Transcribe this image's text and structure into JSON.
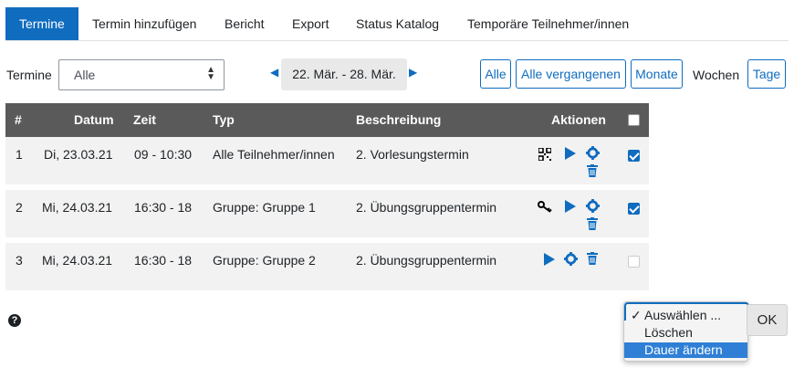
{
  "tabs": [
    "Termine",
    "Termin hinzufügen",
    "Bericht",
    "Export",
    "Status Katalog",
    "Temporäre Teilnehmer/innen"
  ],
  "filter": {
    "label": "Termine",
    "selected": "Alle"
  },
  "date_range": "22. Mär. - 28. Mär.",
  "view_buttons": [
    "Alle",
    "Alle vergangenen",
    "Monate"
  ],
  "view_plain": "Wochen",
  "view_last": "Tage",
  "table": {
    "headers": [
      "#",
      "Datum",
      "Zeit",
      "Typ",
      "Beschreibung",
      "Aktionen"
    ],
    "rows": [
      {
        "num": "1",
        "date": "Di, 23.03.21",
        "time": "09 - 10:30",
        "type": "Alle Teilnehmer/innen",
        "desc": "2. Vorlesungstermin",
        "checked": true
      },
      {
        "num": "2",
        "date": "Mi, 24.03.21",
        "time": "16:30 - 18",
        "type": "Gruppe: Gruppe 1",
        "desc": "2. Übungsgruppentermin",
        "checked": true
      },
      {
        "num": "3",
        "date": "Mi, 24.03.21",
        "time": "16:30 - 18",
        "type": "Gruppe: Gruppe 2",
        "desc": "2. Übungsgruppentermin",
        "checked": false
      }
    ]
  },
  "help_icon": "question-circle-icon",
  "bulk_action": {
    "options": [
      "Auswählen ...",
      "Löschen",
      "Dauer ändern"
    ],
    "selected": "Auswählen ...",
    "highlighted": "Dauer ändern",
    "ok_label": "OK"
  },
  "colors": {
    "accent": "#0f6cbf",
    "header_bg": "#5a5a5a",
    "row_bg": "#f2f2f2"
  }
}
